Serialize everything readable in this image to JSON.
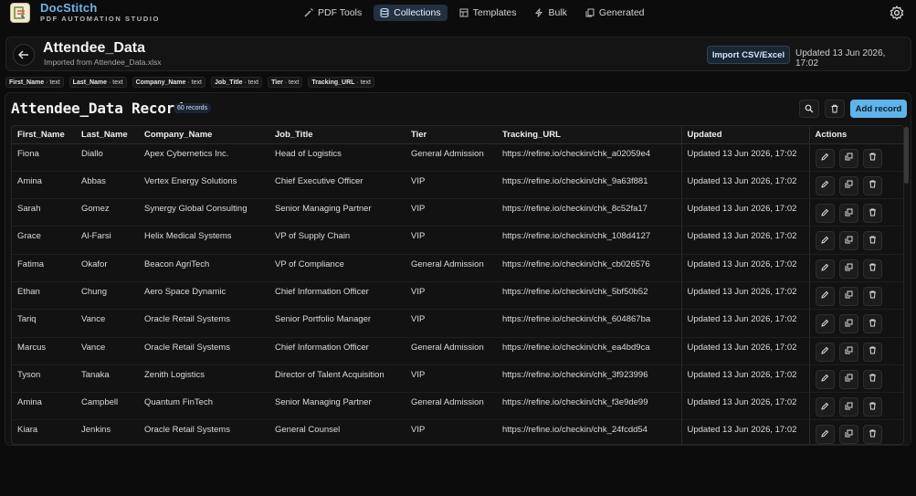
{
  "brand": {
    "name": "DocStitch",
    "subtitle": "PDF AUTOMATION STUDIO"
  },
  "nav": [
    {
      "label": "PDF Tools",
      "icon": "wand-icon",
      "active": false
    },
    {
      "label": "Collections",
      "icon": "database-icon",
      "active": true
    },
    {
      "label": "Templates",
      "icon": "template-icon",
      "active": false
    },
    {
      "label": "Bulk",
      "icon": "bolt-icon",
      "active": false
    },
    {
      "label": "Generated",
      "icon": "file-copy-icon",
      "active": false
    }
  ],
  "header": {
    "title": "Attendee_Data",
    "subtitle": "Imported from Attendee_Data.xlsx",
    "import_label": "Import CSV/Excel",
    "updated": "Updated 13 Jun 2026, 17:02"
  },
  "fields": [
    {
      "name": "First_Name",
      "type": "text"
    },
    {
      "name": "Last_Name",
      "type": "text"
    },
    {
      "name": "Company_Name",
      "type": "text"
    },
    {
      "name": "Job_Title",
      "type": "text"
    },
    {
      "name": "Tier",
      "type": "text"
    },
    {
      "name": "Tracking_URL",
      "type": "text"
    }
  ],
  "records": {
    "title": "Attendee_Data Records",
    "count": "60 records",
    "add_label": "Add record",
    "columns": [
      "First_Name",
      "Last_Name",
      "Company_Name",
      "Job_Title",
      "Tier",
      "Tracking_URL",
      "Updated",
      "Actions"
    ],
    "rows": [
      [
        "Fiona",
        "Diallo",
        "Apex Cybernetics Inc.",
        "Head of Logistics",
        "General Admission",
        "https://refine.io/checkin/chk_a02059e4",
        "Updated 13 Jun 2026, 17:02"
      ],
      [
        "Amina",
        "Abbas",
        "Vertex Energy Solutions",
        "Chief Executive Officer",
        "VIP",
        "https://refine.io/checkin/chk_9a63f881",
        "Updated 13 Jun 2026, 17:02"
      ],
      [
        "Sarah",
        "Gomez",
        "Synergy Global Consulting",
        "Senior Managing Partner",
        "VIP",
        "https://refine.io/checkin/chk_8c52fa17",
        "Updated 13 Jun 2026, 17:02"
      ],
      [
        "Grace",
        "Al-Farsi",
        "Helix Medical Systems",
        "VP of Supply Chain",
        "VIP",
        "https://refine.io/checkin/chk_108d4127",
        "Updated 13 Jun 2026, 17:02"
      ],
      [
        "Fatima",
        "Okafor",
        "Beacon AgriTech",
        "VP of Compliance",
        "General Admission",
        "https://refine.io/checkin/chk_cb026576",
        "Updated 13 Jun 2026, 17:02"
      ],
      [
        "Ethan",
        "Chung",
        "Aero Space Dynamic",
        "Chief Information Officer",
        "VIP",
        "https://refine.io/checkin/chk_5bf50b52",
        "Updated 13 Jun 2026, 17:02"
      ],
      [
        "Tariq",
        "Vance",
        "Oracle Retail Systems",
        "Senior Portfolio Manager",
        "VIP",
        "https://refine.io/checkin/chk_604867ba",
        "Updated 13 Jun 2026, 17:02"
      ],
      [
        "Marcus",
        "Vance",
        "Oracle Retail Systems",
        "Chief Information Officer",
        "General Admission",
        "https://refine.io/checkin/chk_ea4bd9ca",
        "Updated 13 Jun 2026, 17:02"
      ],
      [
        "Tyson",
        "Tanaka",
        "Zenith Logistics",
        "Director of Talent Acquisition",
        "VIP",
        "https://refine.io/checkin/chk_3f923996",
        "Updated 13 Jun 2026, 17:02"
      ],
      [
        "Amina",
        "Campbell",
        "Quantum FinTech",
        "Senior Managing Partner",
        "General Admission",
        "https://refine.io/checkin/chk_f3e9de99",
        "Updated 13 Jun 2026, 17:02"
      ],
      [
        "Kiara",
        "Jenkins",
        "Oracle Retail Systems",
        "General Counsel",
        "VIP",
        "https://refine.io/checkin/chk_24fcdd54",
        "Updated 13 Jun 2026, 17:02"
      ]
    ]
  },
  "colors": {
    "accent": "#5eb4ea",
    "brand": "#6fb3e8",
    "background": "#0c0c0c",
    "panel": "#121212"
  }
}
